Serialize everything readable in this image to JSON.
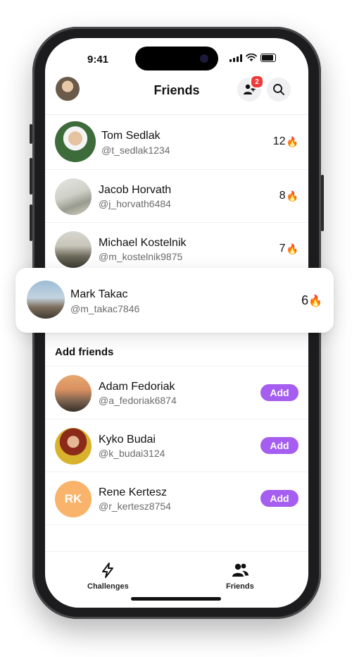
{
  "status": {
    "time": "9:41"
  },
  "header": {
    "title": "Friends",
    "requests_count": "2"
  },
  "friends": [
    {
      "name": "Tom Sedlak",
      "handle": "@t_sedlak1234",
      "streak": "12"
    },
    {
      "name": "Jacob Horvath",
      "handle": "@j_horvath6484",
      "streak": "8"
    },
    {
      "name": "Michael Kostelnik",
      "handle": "@m_kostelnik9875",
      "streak": "7"
    }
  ],
  "highlighted": {
    "name": "Mark Takac",
    "handle": "@m_takac7846",
    "streak": "6"
  },
  "add_friends": {
    "title": "Add friends",
    "items": [
      {
        "name": "Adam Fedoriak",
        "handle": "@a_fedoriak6874",
        "button": "Add"
      },
      {
        "name": "Kyko Budai",
        "handle": "@k_budai3124",
        "button": "Add"
      },
      {
        "name": "Rene Kertesz",
        "handle": "@r_kertesz8754",
        "button": "Add",
        "initials": "RK"
      }
    ]
  },
  "tabs": {
    "challenges": "Challenges",
    "friends": "Friends"
  },
  "colors": {
    "accent": "#a55ef0",
    "badge": "#ee3a3a",
    "streak_fire": "#ff7a18",
    "initials_avatar": "#f9b36a"
  },
  "icons": [
    "add-user-icon",
    "search-icon",
    "fire-icon",
    "lightning-icon",
    "users-icon"
  ]
}
